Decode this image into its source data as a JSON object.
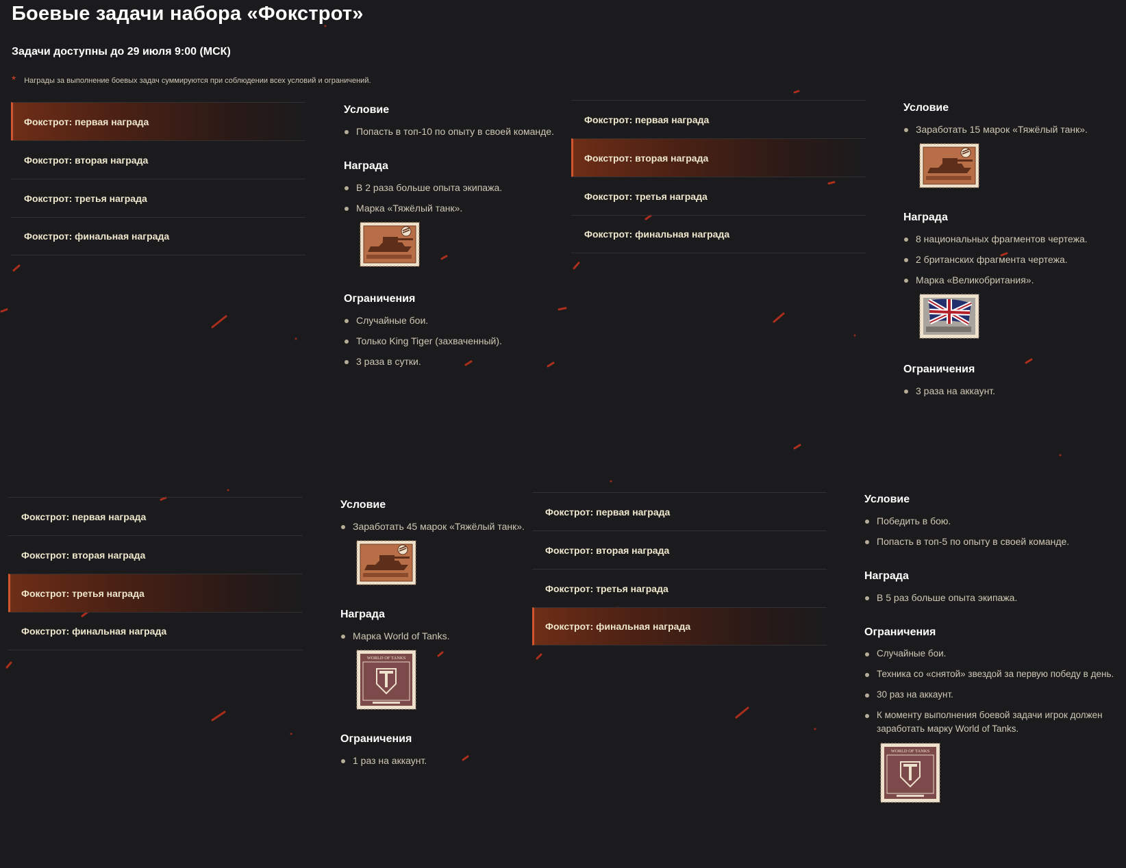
{
  "page": {
    "title": "Боевые задачи набора «Фокстрот»",
    "deadline": "Задачи доступны до 29 июля 9:00 (МСК)",
    "note_star": "*",
    "note": "Награды за выполнение боевых задач суммируются при соблюдении всех условий и ограничений."
  },
  "tabs": [
    "Фокстрот: первая награда",
    "Фокстрот: вторая награда",
    "Фокстрот: третья награда",
    "Фокстрот: финальная награда"
  ],
  "headings": {
    "condition": "Условие",
    "reward": "Награда",
    "limits": "Ограничения"
  },
  "panels": [
    {
      "active_tab": 0,
      "condition": [
        "Попасть в топ-10 по опыту в своей команде."
      ],
      "reward": [
        "В 2 раза больше опыта экипажа.",
        "Марка «Тяжёлый танк»."
      ],
      "reward_stamp": "heavy-tank-stamp",
      "limits": [
        "Случайные бои.",
        "Только King Tiger (захваченный).",
        "3 раза в сутки."
      ]
    },
    {
      "active_tab": 1,
      "condition": [
        "Заработать 15 марок «Тяжёлый танк»."
      ],
      "condition_stamp": "heavy-tank-stamp",
      "reward": [
        "8 национальных фрагментов чертежа.",
        "2 британских фрагмента чертежа.",
        "Марка «Великобритания»."
      ],
      "reward_stamp": "great-britain-stamp",
      "limits": [
        "3 раза на аккаунт."
      ]
    },
    {
      "active_tab": 2,
      "condition": [
        "Заработать 45 марок «Тяжёлый танк»."
      ],
      "condition_stamp": "heavy-tank-stamp",
      "reward": [
        "Марка World of Tanks."
      ],
      "reward_stamp": "world-of-tanks-stamp",
      "limits": [
        "1 раз на аккаунт."
      ]
    },
    {
      "active_tab": 3,
      "condition": [
        "Победить в бою.",
        "Попасть в топ-5 по опыту в своей команде."
      ],
      "reward": [
        "В 5 раз больше опыта экипажа."
      ],
      "limits": [
        "Случайные бои.",
        "Техника со «снятой» звездой за первую победу в день.",
        "30 раз на аккаунт.",
        "К моменту выполнения боевой задачи игрок должен заработать марку World of Tanks."
      ],
      "limits_stamp": "world-of-tanks-stamp"
    }
  ],
  "stamp_text": {
    "wot": "WORLD OF TANKS"
  },
  "colors": {
    "background": "#1b1b1d",
    "accent": "#d2552d",
    "tab_text": "#efe7cd",
    "body_text": "#cfc8b6"
  }
}
